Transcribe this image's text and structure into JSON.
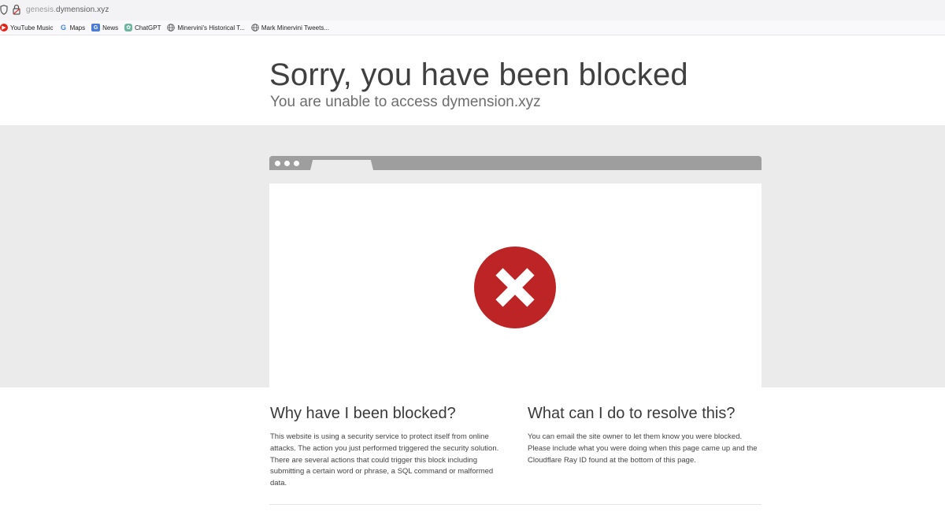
{
  "browser": {
    "url_prefix": "genesis.",
    "url_domain": "dymension.xyz",
    "bookmarks": [
      {
        "label": "YouTube Music",
        "icon": "youtube-music-icon"
      },
      {
        "label": "Maps",
        "icon": "google-icon"
      },
      {
        "label": "News",
        "icon": "news-icon"
      },
      {
        "label": "ChatGPT",
        "icon": "chatgpt-icon"
      },
      {
        "label": "Minervini's Historical T...",
        "icon": "globe-icon"
      },
      {
        "label": "Mark Minervini Tweets...",
        "icon": "globe-icon"
      }
    ]
  },
  "page": {
    "title": "Sorry, you have been blocked",
    "subtitle": "You are unable to access dymension.xyz",
    "why": {
      "heading": "Why have I been blocked?",
      "body": "This website is using a security service to protect itself from online attacks. The action you just performed triggered the security solution. There are several actions that could trigger this block including submitting a certain word or phrase, a SQL command or malformed data."
    },
    "resolve": {
      "heading": "What can I do to resolve this?",
      "body": "You can email the site owner to let them know you were blocked. Please include what you were doing when this page came up and the Cloudflare Ray ID found at the bottom of this page."
    }
  },
  "colors": {
    "error_red": "#bd2426",
    "band_gray": "#ebebeb",
    "illustration_bar": "#9e9e9e"
  }
}
